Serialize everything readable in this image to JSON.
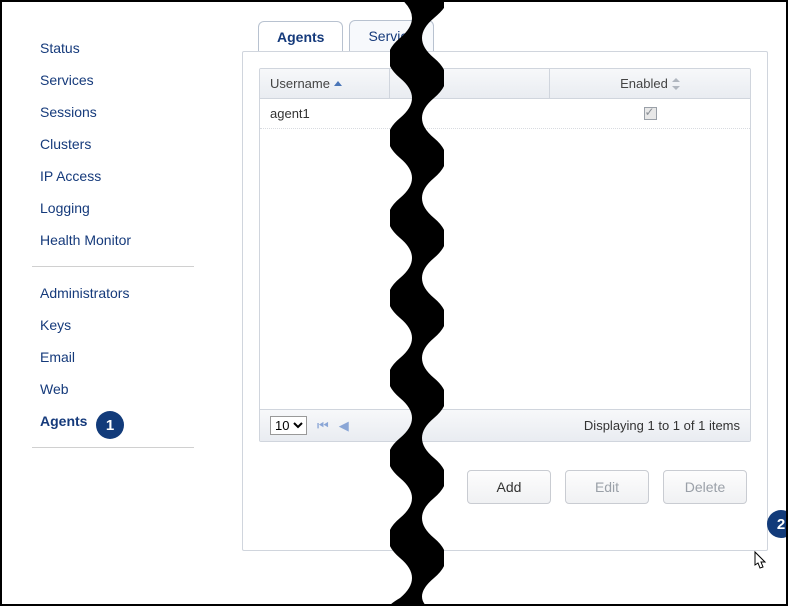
{
  "sidebar": {
    "group1": [
      {
        "label": "Status"
      },
      {
        "label": "Services"
      },
      {
        "label": "Sessions"
      },
      {
        "label": "Clusters"
      },
      {
        "label": "IP Access"
      },
      {
        "label": "Logging"
      },
      {
        "label": "Health Monitor"
      }
    ],
    "group2": [
      {
        "label": "Administrators"
      },
      {
        "label": "Keys"
      },
      {
        "label": "Email"
      },
      {
        "label": "Web"
      },
      {
        "label": "Agents",
        "active": true
      }
    ]
  },
  "tabs": {
    "agents": "Agents",
    "service": "Service"
  },
  "table": {
    "headers": {
      "username": "Username",
      "enabled": "Enabled"
    },
    "rows": [
      {
        "username": "agent1",
        "enabled": true
      }
    ]
  },
  "pager": {
    "page_size": "10",
    "status": "Displaying 1 to 1 of 1 items"
  },
  "buttons": {
    "add": "Add",
    "edit": "Edit",
    "delete": "Delete"
  },
  "callouts": {
    "one": "1",
    "two": "2"
  }
}
